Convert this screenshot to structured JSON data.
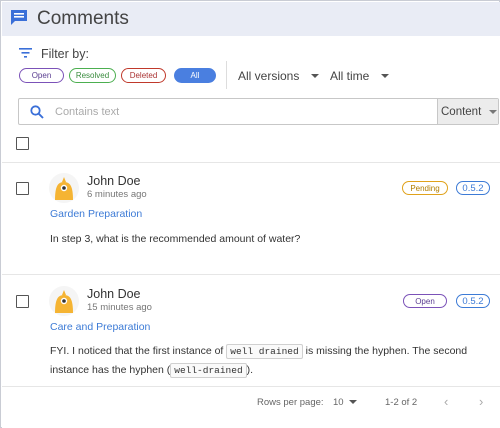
{
  "header": {
    "title": "Comments",
    "icon": "chat-bubble-icon"
  },
  "filter": {
    "label": "Filter by:",
    "chips": {
      "open": "Open",
      "resolved": "Resolved",
      "deleted": "Deleted",
      "all": "All"
    },
    "selected_chip": "All",
    "versions": "All versions",
    "time": "All time"
  },
  "search": {
    "placeholder": "Contains text",
    "value": "",
    "scope": "Content"
  },
  "comments": [
    {
      "author": "John Doe",
      "time": "6 minutes ago",
      "section": "Garden Preparation",
      "status": "Pending",
      "version": "0.5.2",
      "text": "In step 3, what is the recommended amount of water?"
    },
    {
      "author": "John Doe",
      "time": "15 minutes ago",
      "section": "Care and Preparation",
      "status": "Open",
      "version": "0.5.2",
      "text_part1": "FYI. I noticed that the first instance of",
      "code1": "well drained",
      "text_part2": "is missing the hyphen. The second instance has the hyphen (",
      "code2": "well-drained",
      "text_part3": ")."
    }
  ],
  "footer": {
    "rows_label": "Rows per page:",
    "rows_value": "10",
    "range": "1-2 of 2"
  },
  "colors": {
    "accent": "#4a7fe0",
    "header_bg": "#e9ecf5",
    "link": "#3d7bd6"
  }
}
